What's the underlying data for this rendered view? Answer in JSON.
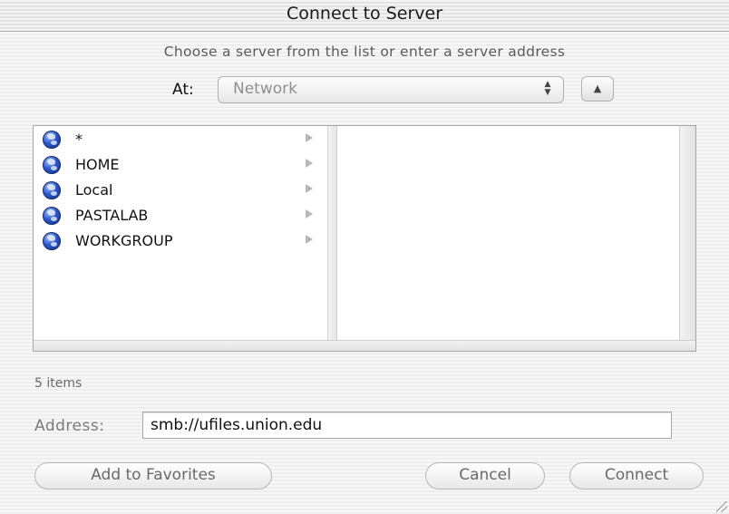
{
  "window": {
    "title": "Connect to Server"
  },
  "instruction": "Choose a server from the list or enter a server address",
  "location": {
    "label": "At:",
    "selected": "Network"
  },
  "browser": {
    "items": [
      {
        "label": "*",
        "icon": "network-globe-icon"
      },
      {
        "label": "HOME",
        "icon": "network-globe-icon"
      },
      {
        "label": "Local",
        "icon": "network-globe-icon"
      },
      {
        "label": "PASTALAB",
        "icon": "network-globe-icon"
      },
      {
        "label": "WORKGROUP",
        "icon": "network-globe-icon"
      }
    ]
  },
  "status": {
    "item_count": "5 items"
  },
  "address": {
    "label": "Address:",
    "value": "smb://ufiles.union.edu"
  },
  "buttons": {
    "add_to_favorites": "Add to Favorites",
    "cancel": "Cancel",
    "connect": "Connect"
  }
}
